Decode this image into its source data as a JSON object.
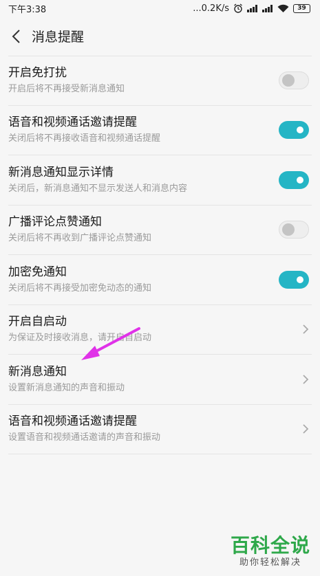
{
  "status_bar": {
    "time": "下午3:38",
    "net_speed": "...0.2K/s",
    "battery": "39"
  },
  "header": {
    "title": "消息提醒"
  },
  "items": [
    {
      "title": "开启免打扰",
      "desc": "开启后将不再接受新消息通知",
      "control": "toggle",
      "on": false
    },
    {
      "title": "语音和视频通话邀请提醒",
      "desc": "关闭后将不再接收语音和视频通话提醒",
      "control": "toggle",
      "on": true
    },
    {
      "title": "新消息通知显示详情",
      "desc": "关闭后，新消息通知不显示发送人和消息内容",
      "control": "toggle",
      "on": true
    },
    {
      "title": "广播评论点赞通知",
      "desc": "关闭后将不再收到广播评论点赞通知",
      "control": "toggle",
      "on": false
    },
    {
      "title": "加密免通知",
      "desc": "关闭后将不再接受加密免动态的通知",
      "control": "toggle",
      "on": true
    },
    {
      "title": "开启自启动",
      "desc": "为保证及时接收消息，请开启自启动",
      "control": "chevron"
    },
    {
      "title": "新消息通知",
      "desc": "设置新消息通知的声音和振动",
      "control": "chevron"
    },
    {
      "title": "语音和视频通话邀请提醒",
      "desc": "设置语音和视频通话邀请的声音和振动",
      "control": "chevron"
    }
  ],
  "watermark": {
    "main": "百科全说",
    "sub": "助你轻松解决"
  },
  "colors": {
    "accent": "#25b5c5",
    "annotation_arrow": "#e032e8",
    "watermark": "#2ea84a"
  }
}
